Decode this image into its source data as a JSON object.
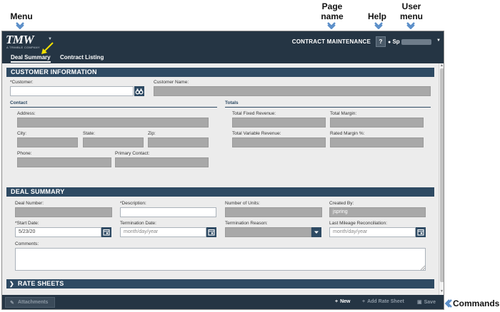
{
  "callouts": {
    "menu": "Menu",
    "page_name_line1": "Page",
    "page_name_line2": "name",
    "help": "Help",
    "user_line1": "User",
    "user_line2": "menu",
    "commands": "Commands"
  },
  "header": {
    "logo": "TMW",
    "logo_sub": "A TRIMBLE COMPANY",
    "page_name": "CONTRACT MAINTENANCE",
    "help_label": "?",
    "user_label": "Sp"
  },
  "tabs": [
    {
      "label": "Deal Summary",
      "active": true
    },
    {
      "label": "Contract Listing",
      "active": false
    }
  ],
  "customer_info": {
    "title": "CUSTOMER INFORMATION",
    "customer_label": "*Customer:",
    "customer_name_label": "Customer Name:",
    "contact_title": "Contact",
    "address_label": "Address:",
    "city_label": "City:",
    "state_label": "State:",
    "zip_label": "Zip:",
    "phone_label": "Phone:",
    "primary_contact_label": "Primary Contact:",
    "totals_title": "Totals",
    "total_fixed_revenue_label": "Total Fixed Revenue:",
    "total_margin_label": "Total Margin:",
    "total_variable_revenue_label": "Total Variable Revenue:",
    "rated_margin_label": "Rated Margin %:"
  },
  "deal_summary": {
    "title": "DEAL SUMMARY",
    "deal_number_label": "Deal Number:",
    "description_label": "*Description:",
    "number_of_units_label": "Number of Units:",
    "created_by_label": "Created By:",
    "created_by_value": "jspring",
    "start_date_label": "*Start Date:",
    "start_date_value": "5/23/20",
    "termination_date_label": "Termination Date:",
    "termination_date_placeholder": "month/day/year",
    "termination_reason_label": "Termination Reason:",
    "last_mileage_label": "Last Mileage Reconciliation:",
    "last_mileage_placeholder": "month/day/year",
    "comments_label": "Comments:"
  },
  "rate_sheets": {
    "title": "RATE SHEETS"
  },
  "commands": {
    "attachments": "Attachments",
    "new": "New",
    "add_rate_sheet": "Add Rate Sheet",
    "save": "Save"
  },
  "colors": {
    "header_bg": "#253544",
    "section_bg": "#2e4a63",
    "readonly_field": "#a8a8a8",
    "callout_arrow": "#5b8fc9",
    "tab_pointer": "#f2e000"
  }
}
